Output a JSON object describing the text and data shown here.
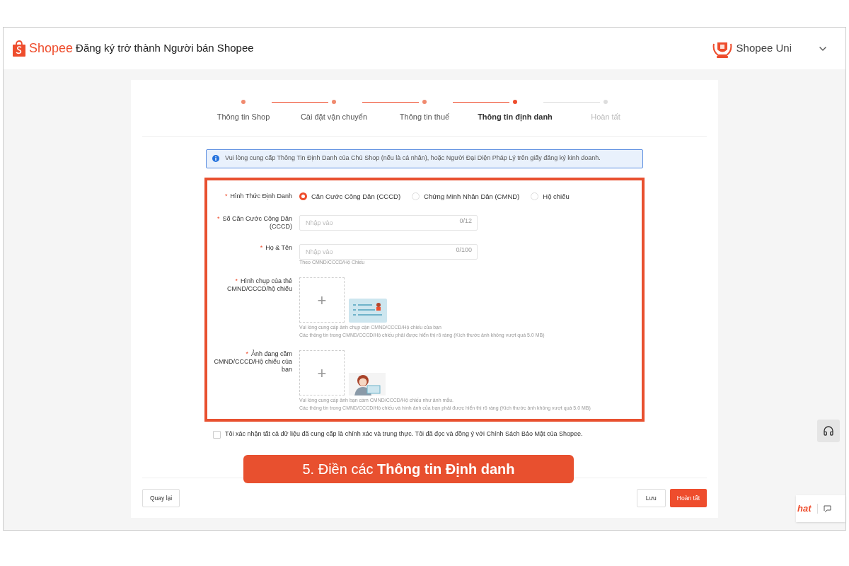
{
  "header": {
    "logo": "Shopee",
    "title": "Đăng ký trở thành Người bán Shopee",
    "account": "Shopee Uni"
  },
  "steps": [
    {
      "label": "Thông tin Shop",
      "completed": true,
      "selected": false
    },
    {
      "label": "Cài đặt vận chuyển",
      "completed": true,
      "selected": false
    },
    {
      "label": "Thông tin thuế",
      "completed": true,
      "selected": false
    },
    {
      "label": "Thông tin định danh",
      "completed": true,
      "selected": true
    },
    {
      "label": "Hoàn tất",
      "completed": false,
      "selected": false
    }
  ],
  "required_mark": "*",
  "notice": "Vui lòng cung cấp Thông Tin Định Danh của Chủ Shop (nếu là cá nhân), hoặc Người Đại Diện Pháp Lý trên giấy đăng ký kinh doanh.",
  "id_type": {
    "label": "Hình Thức Định Danh",
    "options": [
      {
        "label": "Căn Cước Công Dân (CCCD)",
        "selected": true
      },
      {
        "label": "Chứng Minh Nhân Dân (CMND)",
        "selected": false
      },
      {
        "label": "Hộ chiếu",
        "selected": false
      }
    ]
  },
  "fields": [
    {
      "label": "Số Căn Cước Công Dân (CCCD)",
      "placeholder": "Nhập vào",
      "counter": "0/12"
    },
    {
      "label": "Họ & Tên",
      "placeholder": "Nhập vào",
      "counter": "0/100",
      "hint": "Theo CMND/CCCD/Hộ Chiếu"
    }
  ],
  "uploads": [
    {
      "label": "Hình chụp của thẻ CMND/CCCD/hộ chiếu",
      "kind": "card",
      "plus": "+",
      "hints": [
        "Vui lòng cung cấp ảnh chụp cận CMND/CCCD/Hộ chiếu của bạn",
        "Các thông tin trong CMND/CCCD/Hộ chiếu phải được hiển thị rõ ràng (Kích thước ảnh không vượt quá 5.0 MB)"
      ]
    },
    {
      "label": "Ảnh đang cầm CMND/CCCD/Hộ chiếu của bạn",
      "kind": "selfie",
      "plus": "+",
      "hints": [
        "Vui lòng cung cấp ảnh bạn cầm CMND/CCCD/Hộ chiếu như ảnh mẫu.",
        "Các thông tin trong CMND/CCCD/Hộ chiếu và hình ảnh của bạn phải được hiển thị rõ ràng (Kích thước ảnh không vượt quá 5.0 MB)"
      ]
    }
  ],
  "agreement": {
    "label": "Tôi xác nhận tất cả dữ liệu đã cung cấp là chính xác và trung thực. Tôi đã đọc và đồng ý với Chính Sách Bảo Mật của Shopee.",
    "checked": false
  },
  "caption": "5. Điền các **Thông tin Định danh**",
  "buttons": {
    "back": "Quay lại",
    "save": "Lưu",
    "finish": "Hoàn tất"
  },
  "chat": "hat"
}
